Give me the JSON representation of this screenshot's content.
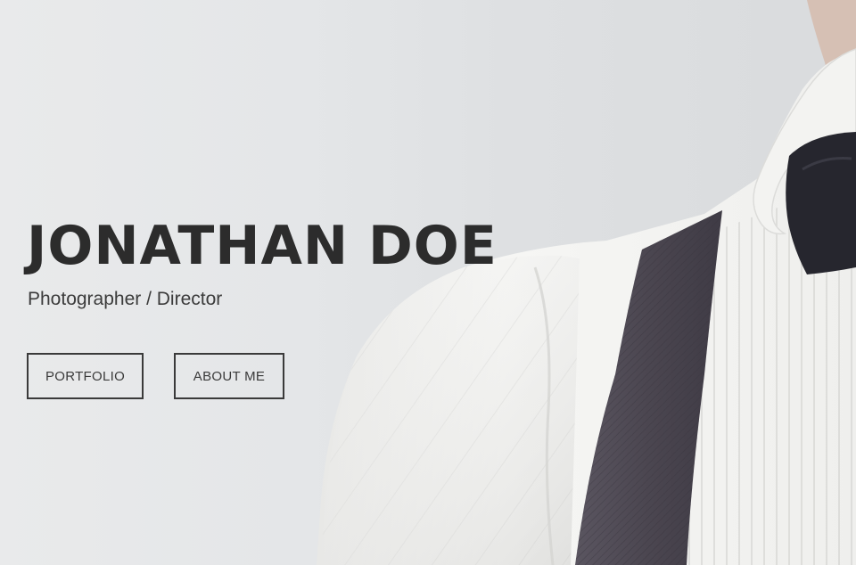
{
  "hero": {
    "title": "JONATHAN DOE",
    "subtitle": "Photographer / Director",
    "buttons": {
      "portfolio": "PORTFOLIO",
      "about": "ABOUT ME"
    }
  },
  "colors": {
    "background": "#e4e6e8",
    "text_dark": "#2c2c2c",
    "button_border": "#3a3a3a",
    "shirt": "#f4f4f2",
    "suspender": "#4e4a52",
    "bow_tie": "#26262e",
    "skin": "#d8c2b6"
  }
}
